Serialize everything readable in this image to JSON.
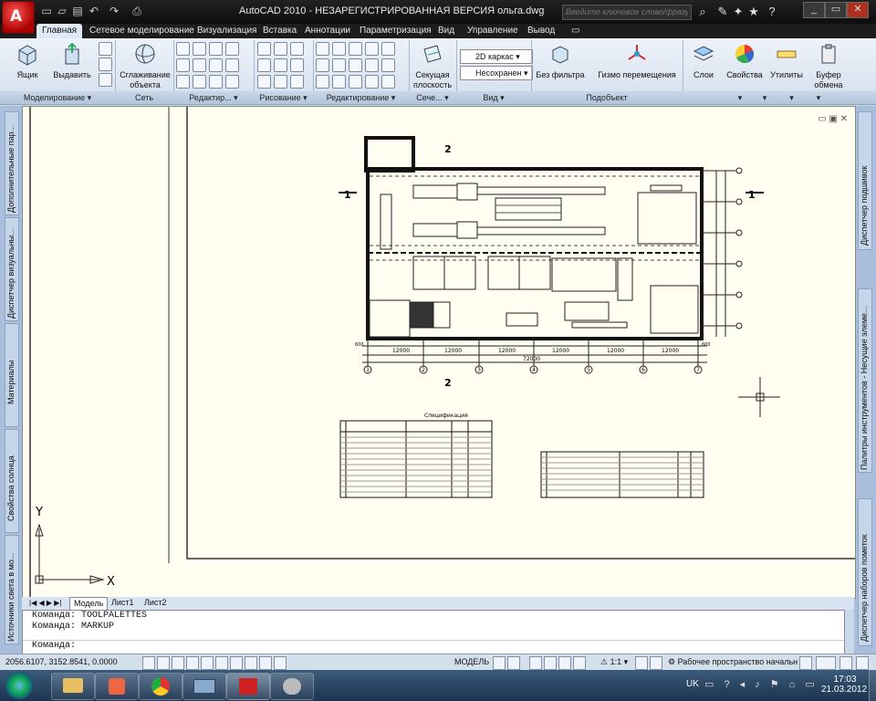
{
  "app": {
    "title": "AutoCAD 2010 - НЕЗАРЕГИСТРИРОВАННАЯ ВЕРСИЯ     ольга.dwg",
    "search_placeholder": "Введите ключевое слово/фразу"
  },
  "ribbon_tabs": [
    "Главная",
    "Сетевое моделирование",
    "Визуализация",
    "Вставка",
    "Аннотации",
    "Параметризация",
    "Вид",
    "Управление",
    "Вывод"
  ],
  "ribbon": {
    "box_label": "Ящик",
    "extrude_label": "Выдавить",
    "smooth_label": "Сглаживание объекта",
    "section_label": "Секущая плоскость",
    "visual_style": "2D каркас",
    "unsaved_view": "Несохранен",
    "no_filter": "Без фильтра",
    "gizmo_label": "Гизмо перемещения",
    "layers_label": "Слои",
    "properties_label": "Свойства",
    "utilities_label": "Утилиты",
    "clipboard_label": "Буфер обмена",
    "panels": [
      "Моделирование ▾",
      "Сеть",
      "Редактир... ▾",
      "Рисование ▾",
      "Редактирование ▾",
      "Сече... ▾",
      "Вид ▾",
      "Подобъект"
    ]
  },
  "left_palettes": [
    "Дополнительные пар...",
    "Диспетчер визуальны...",
    "Материалы",
    "Свойства солнца",
    "Источники света в мо..."
  ],
  "right_palettes": [
    "Диспетчер подшивок",
    "Палитры инструментов - Несущие элеме...",
    "Диспетчер наборов пометок"
  ],
  "drawing": {
    "spec_title": "Спецификация",
    "section_marks": [
      "1",
      "1",
      "2",
      "2"
    ],
    "dims": [
      "12000",
      "12000",
      "12000",
      "12000",
      "12000",
      "12000",
      "72000",
      "600",
      "600"
    ],
    "axes": [
      "1",
      "2",
      "3",
      "4",
      "5",
      "6",
      "7"
    ],
    "axis_y": "Y",
    "axis_x": "X"
  },
  "layout_tabs": [
    "Модель",
    "Лист1",
    "Лист2"
  ],
  "command_lines": [
    "Команда: TOOLPALETTES",
    "Команда: MARKUP",
    "Команда:"
  ],
  "status": {
    "coords": "2056.6107, 3152.8541, 0.0000",
    "model": "МОДЕЛЬ",
    "scale": "1:1",
    "workspace": "Рабочее пространство начальн"
  },
  "taskbar": {
    "lang": "UK",
    "time": "17:03",
    "date": "21.03.2012"
  },
  "colors": {
    "titlebar": "#111111",
    "ribbon": "#dfe9f5",
    "canvas": "#fffef0",
    "taskbar": "#2a4565"
  }
}
